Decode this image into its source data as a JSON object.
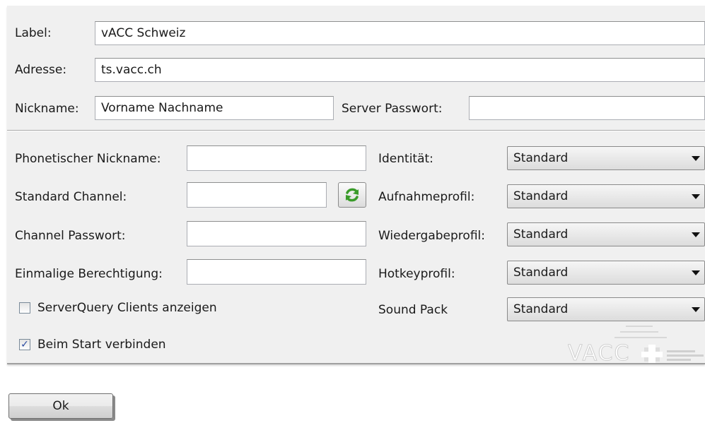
{
  "connection": {
    "label_label": "Label:",
    "label_value": "vACC Schweiz",
    "address_label": "Adresse:",
    "address_value": "ts.vacc.ch",
    "nickname_label": "Nickname:",
    "nickname_value": "Vorname Nachname",
    "server_password_label": "Server Passwort:",
    "server_password_value": ""
  },
  "advanced": {
    "phonetic_nickname_label": "Phonetischer Nickname:",
    "phonetic_nickname_value": "",
    "default_channel_label": "Standard Channel:",
    "default_channel_value": "",
    "channel_password_label": "Channel Passwort:",
    "channel_password_value": "",
    "one_time_permission_label": "Einmalige Berechtigung:",
    "one_time_permission_value": "",
    "serverquery_label": "ServerQuery Clients anzeigen",
    "serverquery_checked": false,
    "connect_on_start_label": "Beim Start verbinden",
    "connect_on_start_checked": true,
    "refresh_icon": "refresh-icon"
  },
  "profiles": {
    "identity_label": "Identität:",
    "identity_value": "Standard",
    "capture_label": "Aufnahmeprofil:",
    "capture_value": "Standard",
    "playback_label": "Wiedergabeprofil:",
    "playback_value": "Standard",
    "hotkey_label": "Hotkeyprofil:",
    "hotkey_value": "Standard",
    "soundpack_label": "Sound Pack",
    "soundpack_value": "Standard"
  },
  "logo": {
    "text": "VACC"
  },
  "buttons": {
    "ok_label": "Ok"
  },
  "colors": {
    "panel": "#f0f0f0",
    "field_border": "#abadb3",
    "checkmark": "#2a4aa0",
    "refresh_green": "#3a9b2a"
  }
}
